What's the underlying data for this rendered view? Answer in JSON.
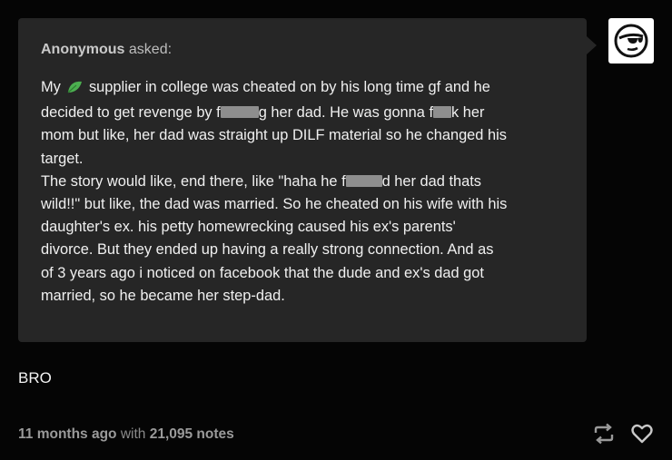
{
  "ask": {
    "asker_name": "Anonymous",
    "asked_label": "asked:",
    "lines": [
      {
        "before": "My ",
        "leaf_icon": "leaf-icon",
        "after": " supplier in college was cheated on by his long time gf and he"
      },
      {
        "before": "decided to get revenge by f",
        "after": "g her dad. He was gonna f",
        "after2": "k her"
      },
      {
        "text": "mom but like, her dad was straight up DILF material so he changed his"
      },
      {
        "text": "target."
      },
      {
        "text": "The story would like, end there, like \"haha he f",
        "after": "d her dad thats"
      },
      {
        "text": "wild!!\" but like, the dad was married. So he cheated on his wife with his"
      },
      {
        "text": "daughter's ex. his petty homewrecking caused his ex's parents'"
      },
      {
        "text": "divorce. But they ended up having a really strong connection. And as"
      },
      {
        "text": "of 3 years ago i noticed on facebook that the dude and ex's dad got"
      },
      {
        "text": "married, so he became her step-dad."
      }
    ]
  },
  "answer": {
    "text": "BRO"
  },
  "footer": {
    "time": "11 months ago",
    "with": " with ",
    "notes": "21,095 notes"
  },
  "icons": {
    "avatar": "sunglasses-face-icon",
    "reblog": "reblog-icon",
    "like": "heart-icon"
  },
  "colors": {
    "background": "#050505",
    "bubble": "#262626",
    "leaf": "#4caf50"
  }
}
